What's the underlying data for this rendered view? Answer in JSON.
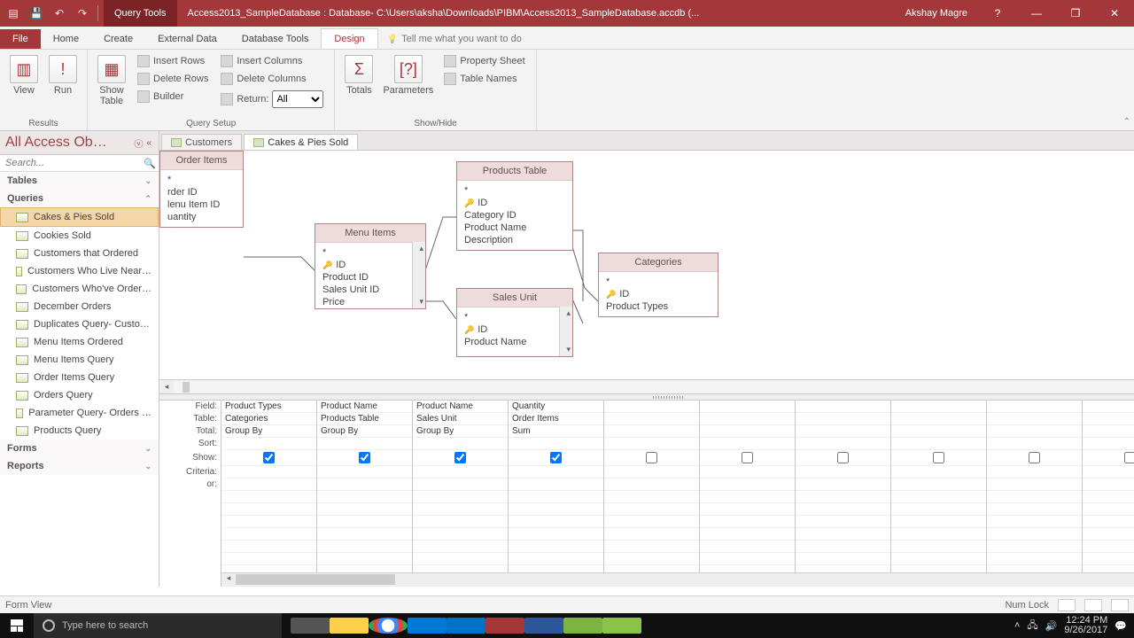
{
  "titlebar": {
    "context_tab": "Query Tools",
    "doc_title": "Access2013_SampleDatabase : Database- C:\\Users\\aksha\\Downloads\\PIBM\\Access2013_SampleDatabase.accdb (...",
    "user": "Akshay Magre"
  },
  "ribbontabs": {
    "file": "File",
    "tabs": [
      "Home",
      "Create",
      "External Data",
      "Database Tools",
      "Design"
    ],
    "active": "Design",
    "tell": "Tell me what you want to do"
  },
  "ribbon": {
    "results": {
      "label": "Results",
      "view": "View",
      "run": "Run"
    },
    "querytype": {
      "show_table": "Show\nTable"
    },
    "querysetup": {
      "label": "Query Setup",
      "insert_rows": "Insert Rows",
      "delete_rows": "Delete Rows",
      "builder": "Builder",
      "insert_cols": "Insert Columns",
      "delete_cols": "Delete Columns",
      "return": "Return:",
      "return_val": "All"
    },
    "showhide": {
      "label": "Show/Hide",
      "totals": "Totals",
      "params": "Parameters",
      "propsheet": "Property Sheet",
      "tablenames": "Table Names"
    }
  },
  "nav": {
    "title": "All Access Ob…",
    "search_ph": "Search...",
    "groups": {
      "tables": "Tables",
      "queries": "Queries",
      "forms": "Forms",
      "reports": "Reports"
    },
    "queries": [
      "Cakes & Pies Sold",
      "Cookies Sold",
      "Customers that Ordered",
      "Customers Who Live Near…",
      "Customers Who've Order…",
      "December Orders",
      "Duplicates Query- Custo…",
      "Menu Items Ordered",
      "Menu Items Query",
      "Order Items Query",
      "Orders Query",
      "Parameter Query- Orders …",
      "Products Query"
    ]
  },
  "doctabs": {
    "t1": "Customers",
    "t2": "Cakes & Pies Sold"
  },
  "diagram": {
    "order_items": {
      "title": "Order Items",
      "f1": "*",
      "f2": "rder ID",
      "f3": "lenu Item ID",
      "f4": "uantity"
    },
    "menu_items": {
      "title": "Menu Items",
      "f1": "*",
      "f2": "ID",
      "f3": "Product ID",
      "f4": "Sales Unit ID",
      "f5": "Price"
    },
    "products": {
      "title": "Products Table",
      "f1": "*",
      "f2": "ID",
      "f3": "Category ID",
      "f4": "Product Name",
      "f5": "Description"
    },
    "sales_unit": {
      "title": "Sales Unit",
      "f1": "*",
      "f2": "ID",
      "f3": "Product Name"
    },
    "categories": {
      "title": "Categories",
      "f1": "*",
      "f2": "ID",
      "f3": "Product Types"
    }
  },
  "grid": {
    "labels": {
      "field": "Field:",
      "table": "Table:",
      "total": "Total:",
      "sort": "Sort:",
      "show": "Show:",
      "criteria": "Criteria:",
      "or": "or:"
    },
    "cols": [
      {
        "field": "Product Types",
        "table": "Categories",
        "total": "Group By",
        "show": true
      },
      {
        "field": "Product Name",
        "table": "Products Table",
        "total": "Group By",
        "show": true
      },
      {
        "field": "Product Name",
        "table": "Sales Unit",
        "total": "Group By",
        "show": true
      },
      {
        "field": "Quantity",
        "table": "Order Items",
        "total": "Sum",
        "show": true
      },
      {
        "field": "",
        "table": "",
        "total": "",
        "show": false
      },
      {
        "field": "",
        "table": "",
        "total": "",
        "show": false
      },
      {
        "field": "",
        "table": "",
        "total": "",
        "show": false
      },
      {
        "field": "",
        "table": "",
        "total": "",
        "show": false
      },
      {
        "field": "",
        "table": "",
        "total": "",
        "show": false
      },
      {
        "field": "",
        "table": "",
        "total": "",
        "show": false
      }
    ]
  },
  "status": {
    "left": "Form View",
    "numlock": "Num Lock"
  },
  "taskbar": {
    "search_ph": "Type here to search",
    "time": "12:24 PM",
    "date": "9/26/2017"
  }
}
